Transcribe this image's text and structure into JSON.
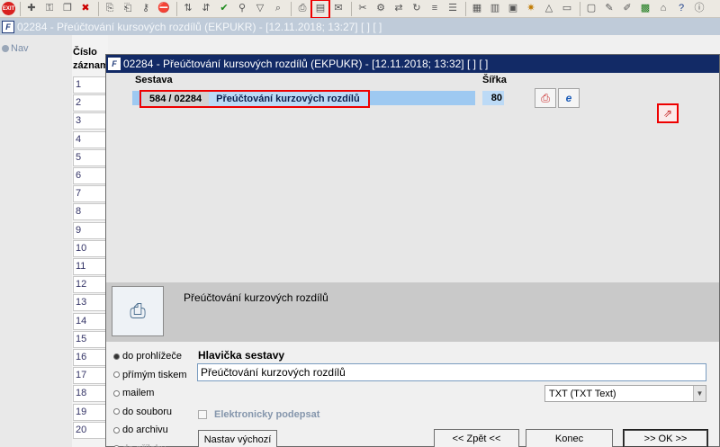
{
  "toolbar": {
    "exit_label": "EXIT",
    "icons": [
      "add-record-icon",
      "lock-icon",
      "copy-icon",
      "delete-icon",
      "sort-icon",
      "checkmark-icon",
      "key-icon",
      "filter-icon",
      "print-icon",
      "printer-export-icon",
      "send-icon",
      "cut-icon",
      "tools-icon",
      "arrows-icon",
      "list-icon",
      "grid-icon",
      "calendar-icon",
      "chart-icon",
      "report-icon",
      "document-icon",
      "excel-icon",
      "help-icon",
      "help-question-icon",
      "info-icon"
    ]
  },
  "main_window": {
    "title": "02284 - Přeúčtování kursových rozdílů (EKPUKR) - [12.11.2018; 13:27]  [ ]  [ ]",
    "nav_label": "Nav",
    "column_header_line1": "Číslo",
    "column_header_line2": "záznam",
    "rows": [
      "1",
      "2",
      "3",
      "4",
      "5",
      "6",
      "7",
      "8",
      "9",
      "10",
      "11",
      "12",
      "13",
      "14",
      "15",
      "16",
      "17",
      "18",
      "19",
      "20"
    ]
  },
  "dialog": {
    "title": "02284 - Přeúčtování kursových rozdílů (EKPUKR) - [12.11.2018; 13:32]  [ ]  [ ]",
    "col_sestava": "Sestava",
    "col_sirka": "Šířka",
    "selected_report": {
      "code": "584 / 02284",
      "name": "Přeúčtování kurzových rozdílů",
      "width": "80"
    },
    "description": "Přeúčtování kurzových rozdílů",
    "output_options": [
      {
        "label": "do prohlížeče",
        "selected": true,
        "disabled": false
      },
      {
        "label": "přímým tiskem",
        "selected": false,
        "disabled": false
      },
      {
        "label": "mailem",
        "selected": false,
        "disabled": false
      },
      {
        "label": "do souboru",
        "selected": false,
        "disabled": false
      },
      {
        "label": "do archivu",
        "selected": false,
        "disabled": false
      },
      {
        "label": "do přílohy",
        "selected": false,
        "disabled": true
      }
    ],
    "header_label": "Hlavička sestavy",
    "header_value": "Přeúčtování kurzových rozdílů",
    "format_value": "TXT (TXT Text)",
    "esign_label": "Elektronicky podepsat",
    "btn_default": "Nastav výchozí",
    "btn_back": "<< Zpět <<",
    "btn_end": "Konec",
    "btn_ok": ">> OK >>"
  }
}
